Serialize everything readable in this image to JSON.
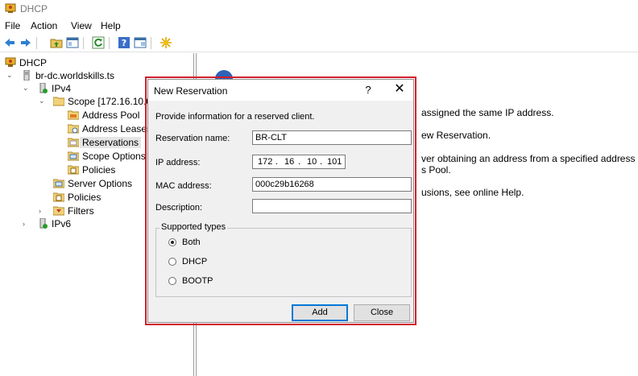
{
  "window": {
    "title": "DHCP",
    "icon": "dhcp-app-icon"
  },
  "menu": [
    "File",
    "Action",
    "View",
    "Help"
  ],
  "toolbar": {
    "icons": [
      "back-arrow-icon",
      "forward-arrow-icon",
      "up-folder-icon",
      "show-hide-tree-icon",
      "refresh-icon",
      "help-icon",
      "properties-icon",
      "star-new-icon"
    ]
  },
  "tree": {
    "root": "DHCP",
    "server": "br-dc.worldskills.ts",
    "ipv4": "IPv4",
    "scope": "Scope [172.16.10.0",
    "address_pool": "Address Pool",
    "address_leases": "Address Leases",
    "reservations": "Reservations",
    "scope_options": "Scope Options",
    "scope_policies": "Policies",
    "server_options": "Server Options",
    "policies": "Policies",
    "filters": "Filters",
    "ipv6": "IPv6"
  },
  "right_pane": {
    "lines": [
      "assigned the same IP address.",
      "ew Reservation.",
      "ver obtaining an address from a specified address",
      "s Pool.",
      "usions, see online Help."
    ]
  },
  "dialog": {
    "title": "New Reservation",
    "help_glyph": "?",
    "close_glyph": "✕",
    "instruction": "Provide information for a reserved client.",
    "reservation_name_label": "Reservation name:",
    "reservation_name_value": "BR-CLT",
    "ip_label": "IP address:",
    "ip_octets": [
      "172",
      "16",
      "10",
      "101"
    ],
    "mac_label": "MAC address:",
    "mac_value": "000c29b16268",
    "description_label": "Description:",
    "description_value": "",
    "supported_types_label": "Supported types",
    "types": [
      {
        "label": "Both",
        "checked": true
      },
      {
        "label": "DHCP",
        "checked": false
      },
      {
        "label": "BOOTP",
        "checked": false
      }
    ],
    "add_label": "Add",
    "close_label": "Close"
  },
  "colors": {
    "highlight_border": "#d0202a",
    "dialog_bg": "#f0f0f0",
    "default_button_border": "#0078d7"
  }
}
